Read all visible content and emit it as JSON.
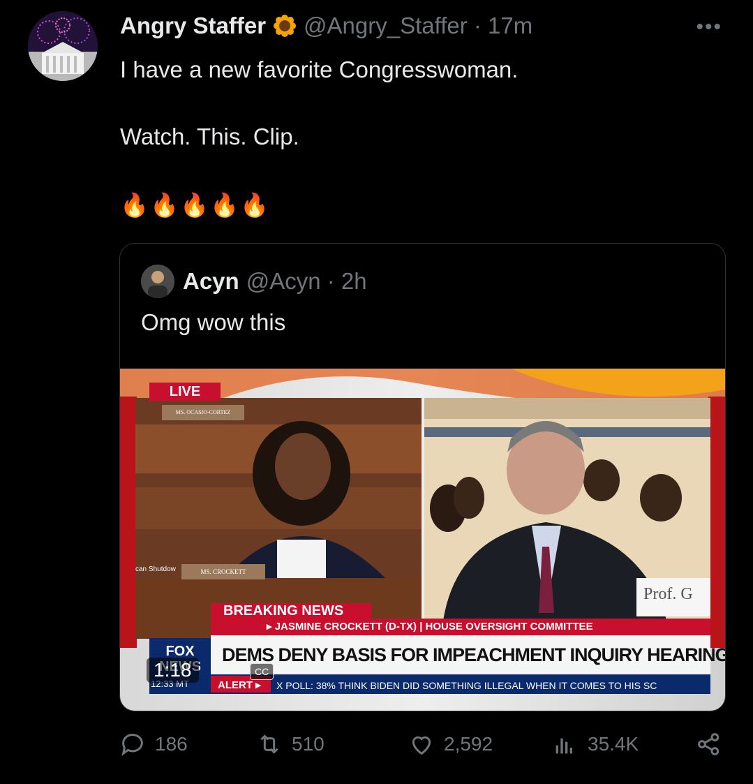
{
  "tweet": {
    "author_name": "Angry Staffer",
    "verified_badge_icon": "sunflower-badge-icon",
    "handle_time": "@Angry_Staffer · 17m",
    "more_icon": "ellipsis-icon",
    "more_label": "•••",
    "line1": "I have a new favorite Congresswoman.",
    "line2": "Watch. This. Clip.",
    "emojis": [
      "🔥",
      "🔥",
      "🔥",
      "🔥",
      "🔥"
    ]
  },
  "quote": {
    "author_name": "Acyn",
    "handle_time": "@Acyn · 2h",
    "text": "Omg wow this",
    "video": {
      "live_label": "LIVE",
      "nameplate_left": "MS. OCASIO-CORTEZ",
      "nameplate_crockett": "MS. CROCKETT",
      "side_ticker": "can Shutdow",
      "nameplate_right": "Prof. G",
      "breaking_label": "BREAKING NEWS",
      "subheadline": "▸ JASMINE CROCKETT (D-TX) | HOUSE OVERSIGHT COMMITTEE",
      "headline": "DEMS DENY BASIS FOR IMPEACHMENT INQUIRY HEARING",
      "channel": "FOX NEWS",
      "clock": "12:33 MT",
      "alert_label": "ALERT ▸",
      "ticker": "X POLL: 38% THINK BIDEN DID SOMETHING ILLEGAL WHEN IT COMES TO HIS SC",
      "duration": "1:18",
      "cc_label": "CC"
    }
  },
  "actions": {
    "replies": "186",
    "retweets": "510",
    "likes": "2,592",
    "views": "35.4K"
  },
  "colors": {
    "fox_red": "#c8102e",
    "fox_blue": "#0a2a6b",
    "muted": "#71767b"
  }
}
